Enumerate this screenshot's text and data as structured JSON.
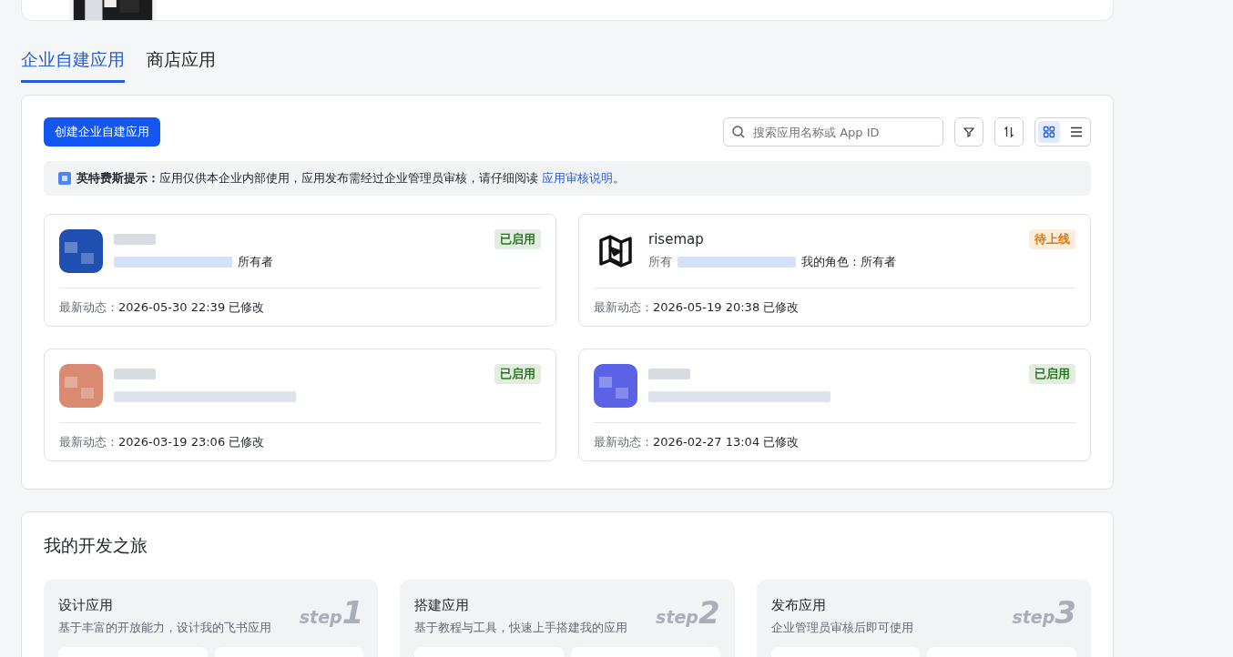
{
  "tabs": [
    {
      "label": "企业自建应用",
      "selected": true
    },
    {
      "label": "商店应用",
      "selected": false
    }
  ],
  "toolbar": {
    "create_button": "创建企业自建应用",
    "search": {
      "placeholder": "搜索应用名称或 App ID"
    },
    "view": [
      {
        "kind": "grid",
        "selected": true
      },
      {
        "kind": "list",
        "selected": false
      }
    ]
  },
  "notice": {
    "title": "英特费斯提示：",
    "text": "应用仅供本企业内部使用，应用发布需经过企业管理员审核，请仔细阅读",
    "link": "应用审核说明",
    "end": "。"
  },
  "apps": [
    {
      "meta": [
        "所有者"
      ],
      "status": "已启用",
      "color": "#237b19",
      "updated_label": "最新动态：",
      "updated": "2026-05-30 22:39 已修改"
    },
    {
      "name": "risemap",
      "meta": [
        "所有",
        "我的角色：所有者"
      ],
      "status": "待上线",
      "color": "#de7802",
      "updated_label": "最新动态：",
      "updated": "2026-05-19 20:38 已修改"
    },
    {
      "status": "已启用",
      "color": "#237b19",
      "updated_label": "最新动态：",
      "updated": "2026-03-19 23:06 已修改"
    },
    {
      "status": "已启用",
      "color": "#237b19",
      "updated_label": "最新动态：",
      "updated": "2026-02-27 13:04 已修改"
    }
  ],
  "journey": {
    "title": "我的开发之旅",
    "steps": [
      {
        "title": "设计应用",
        "text": "基于丰富的开放能力，设计我的飞书应用",
        "step": "step",
        "number": "1"
      },
      {
        "title": "搭建应用",
        "text": "基于教程与工具，快速上手搭建我的应用",
        "step": "step",
        "number": "2"
      },
      {
        "title": "发布应用",
        "text": "企业管理员审核后即可使用",
        "step": "step",
        "number": "3"
      }
    ]
  }
}
